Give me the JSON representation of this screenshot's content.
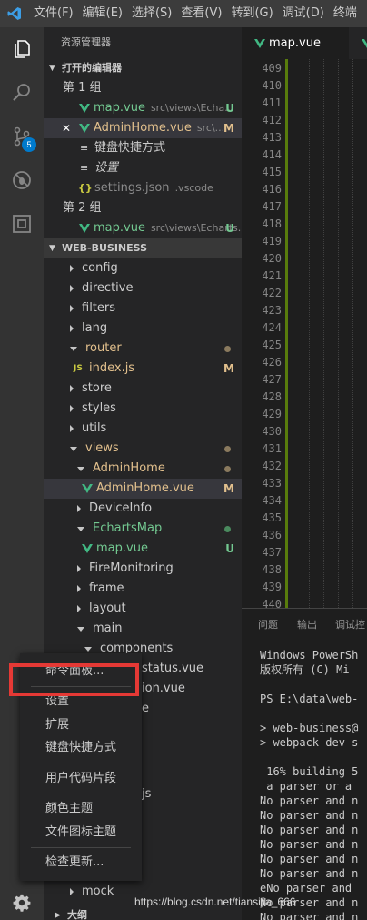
{
  "menubar": {
    "items": [
      "文件(F)",
      "编辑(E)",
      "选择(S)",
      "查看(V)",
      "转到(G)",
      "调试(D)",
      "终端"
    ]
  },
  "activity": {
    "icons": [
      "explorer-icon",
      "search-icon",
      "source-control-icon",
      "debug-icon",
      "extensions-icon"
    ],
    "scm_badge": "5",
    "manage_icon": "gear-icon"
  },
  "sidebar": {
    "title": "资源管理器",
    "open_editors_header": "打开的编辑器",
    "group1_label": "第 1 组",
    "group2_label": "第 2 组",
    "open_editors": {
      "g1_0": {
        "name": "map.vue",
        "path": "src\\views\\Echa...",
        "status": "U"
      },
      "g1_1": {
        "close": "✕",
        "name": "AdminHome.vue",
        "path": "src\\...",
        "status": "M"
      },
      "g1_2": {
        "name": "键盘快捷方式"
      },
      "g1_3": {
        "name": "设置"
      },
      "g1_4": {
        "name": "settings.json",
        "path": ".vscode"
      },
      "g2_0": {
        "name": "map.vue",
        "path": "src\\views\\Echarts...",
        "status": "U"
      }
    },
    "workspace_header": "WEB-BUSINESS",
    "tree": {
      "config": "config",
      "directive": "directive",
      "filters": "filters",
      "lang": "lang",
      "router": "router",
      "indexjs": "index.js",
      "indexjs_status": "M",
      "store": "store",
      "styles": "styles",
      "utils": "utils",
      "views": "views",
      "adminhome_folder": "AdminHome",
      "adminhome_vue": "AdminHome.vue",
      "adminhome_vue_status": "M",
      "deviceinfo": "DeviceInfo",
      "echartsmap": "EchartsMap",
      "mapvue": "map.vue",
      "mapvue_status": "U",
      "firemonitoring": "FireMonitoring",
      "frame": "frame",
      "layout": "layout",
      "main": "main",
      "components": "components",
      "status_vue": "status.vue",
      "ion_vue": "ion.vue",
      "e_partial": "e",
      "js_partial": "js",
      "mock": "mock",
      "outline": "大纲"
    }
  },
  "editor": {
    "tab_label": "map.vue",
    "line_numbers": [
      "409",
      "410",
      "411",
      "412",
      "413",
      "414",
      "415",
      "416",
      "417",
      "418",
      "419",
      "420",
      "421",
      "422",
      "423",
      "424",
      "425",
      "426",
      "427",
      "428",
      "429",
      "430",
      "431",
      "432",
      "433",
      "434",
      "435",
      "436",
      "437",
      "438",
      "439",
      "440"
    ]
  },
  "panel": {
    "tabs": [
      "问题",
      "输出",
      "调试控"
    ],
    "terminal_lines": [
      "Windows PowerSh",
      "版权所有 (C) Mi",
      "",
      "PS E:\\data\\web-",
      "",
      "> web-business@",
      "> webpack-dev-s",
      "",
      " 16% building 5",
      " a parser or a ",
      "No parser and n",
      "No parser and n",
      "No parser and n",
      "No parser and n",
      "No parser and n",
      "No parser and n",
      "eNo parser and ",
      "No parser and n",
      "No parser and n"
    ]
  },
  "context_menu": {
    "items": [
      "命令面板...",
      "设置",
      "扩展",
      "键盘快捷方式",
      "用户代码片段",
      "颜色主题",
      "文件图标主题",
      "检查更新..."
    ]
  },
  "watermark": "https://blog.csdn.net/tiansijia_666",
  "colors": {
    "untracked": "#73c991",
    "modified": "#e2c08d",
    "accent": "#007acc",
    "highlight_box": "#e53935"
  }
}
